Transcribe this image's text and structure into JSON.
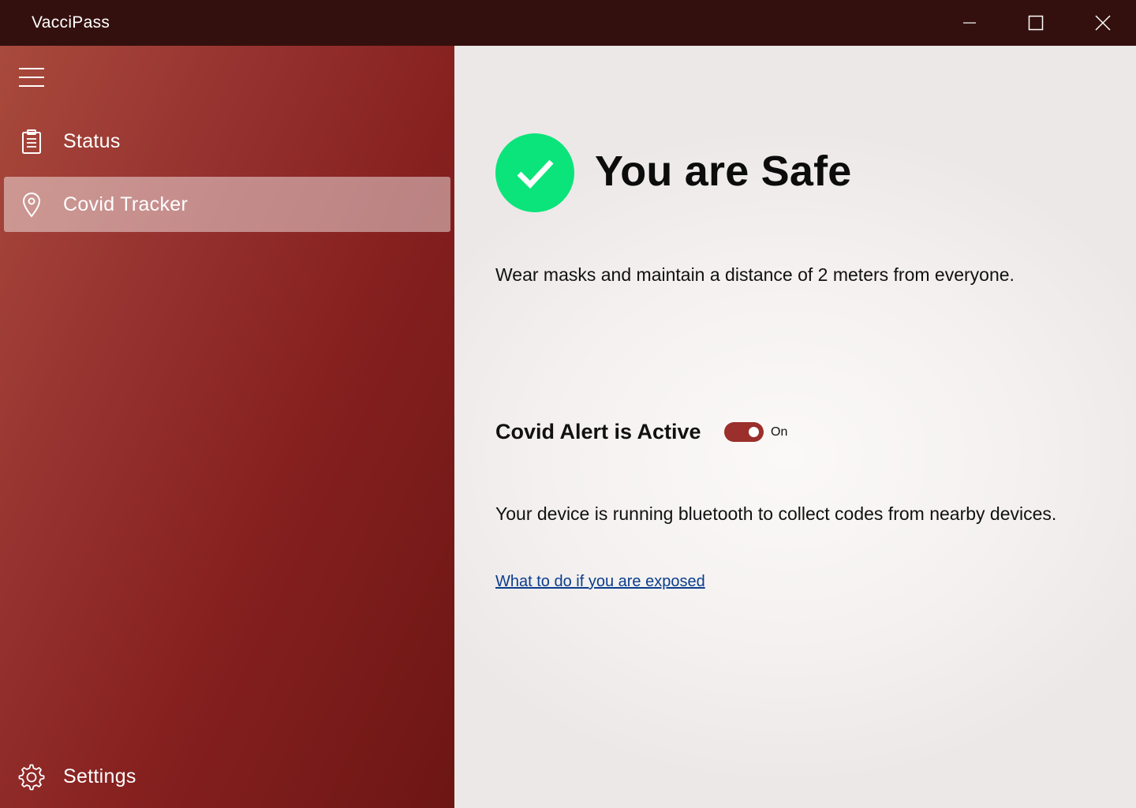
{
  "window": {
    "title": "VacciPass",
    "controls": {
      "minimize": "minimize-icon",
      "maximize": "maximize-icon",
      "close": "close-icon"
    }
  },
  "sidebar": {
    "menu_icon": "hamburger-icon",
    "items": [
      {
        "label": "Status",
        "icon": "clipboard-icon",
        "selected": false
      },
      {
        "label": "Covid Tracker",
        "icon": "location-pin-icon",
        "selected": true
      }
    ],
    "footer": {
      "label": "Settings",
      "icon": "gear-icon"
    }
  },
  "main": {
    "status_icon": "check-circle-icon",
    "status_title": "You are Safe",
    "advice": "Wear masks and maintain a distance of 2 meters from everyone.",
    "alert": {
      "label": "Covid Alert is Active",
      "toggle_state": "On",
      "enabled": true
    },
    "bluetooth_info": "Your device is running bluetooth to collect codes from nearby devices.",
    "link": "What to do if you are exposed"
  },
  "colors": {
    "titlebar": "#33100e",
    "sidebar_accent": "#973330",
    "safe_green": "#0be47a",
    "toggle_on": "#9a2f2b",
    "link": "#0b3d8c"
  }
}
